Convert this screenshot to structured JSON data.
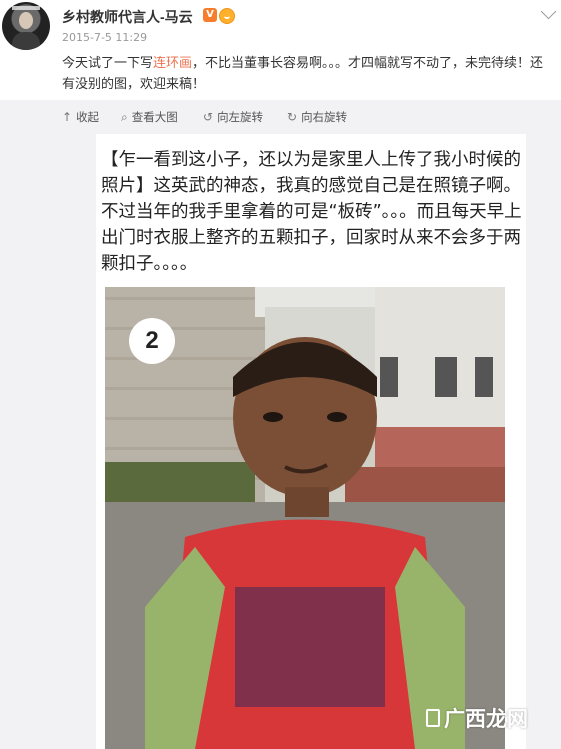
{
  "post": {
    "username": "乡村教师代言人-马云",
    "verified_badge": "V",
    "timestamp": "2015-7-5 11:29",
    "text_before_link": "今天试了一下写",
    "text_link": "连环画",
    "text_after_link": "，不比当董事长容易啊。。。才四幅就写不动了，未完待续！还有没别的图，欢迎来稿！",
    "icons": {
      "verified": "verified-v-icon",
      "member": "member-icon",
      "more": "chevron-down-icon"
    }
  },
  "toolbar": {
    "collapse": "收起",
    "view_large": "查看大图",
    "rotate_left": "向左旋转",
    "rotate_right": "向右旋转"
  },
  "content": {
    "caption": "【乍一看到这小子，还以为是家里人上传了我小时候的照片】这英武的神态，我真的感觉自己是在照镜子啊。不过当年的我手里拿着的可是“板砖”。。。而且每天早上出门时衣服上整齐的五颗扣子，回家时从来不会多于两颗扣子。。。。",
    "photo_number": "2"
  },
  "watermark": {
    "text": "广西龙网"
  },
  "colors": {
    "link": "#eb7350",
    "toolbar_bg": "#f2f2f5",
    "badge_orange": "#f77d2c"
  }
}
